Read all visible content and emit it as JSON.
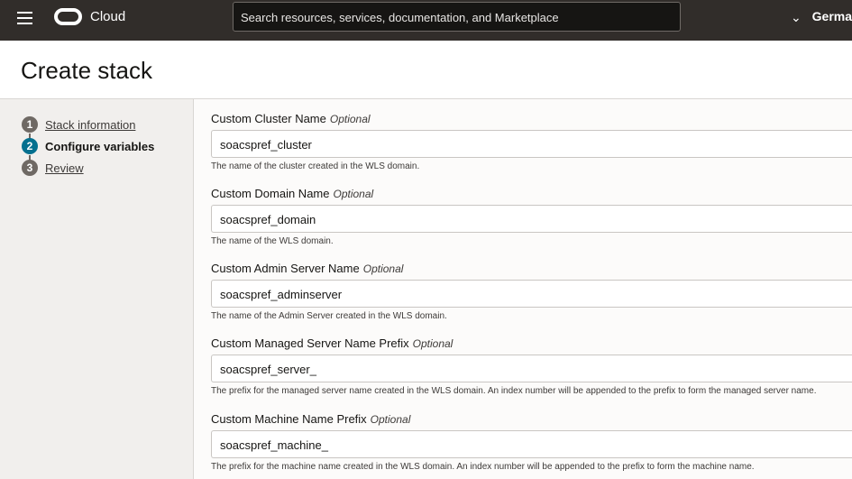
{
  "header": {
    "brand": "Cloud",
    "search_placeholder": "Search resources, services, documentation, and Marketplace",
    "region": "Germa"
  },
  "page_title": "Create stack",
  "steps": [
    {
      "num": "1",
      "label": "Stack information"
    },
    {
      "num": "2",
      "label": "Configure variables"
    },
    {
      "num": "3",
      "label": "Review"
    }
  ],
  "optional": "Optional",
  "fields": [
    {
      "label": "Custom Cluster Name",
      "value": "soacspref_cluster",
      "help": "The name of the cluster created in the WLS domain."
    },
    {
      "label": "Custom Domain Name",
      "value": "soacspref_domain",
      "help": "The name of the WLS domain."
    },
    {
      "label": "Custom Admin Server Name",
      "value": "soacspref_adminserver",
      "help": "The name of the Admin Server created in the WLS domain."
    },
    {
      "label": "Custom Managed Server Name Prefix",
      "value": "soacspref_server_",
      "help": "The prefix for the managed server name created in the WLS domain. An index number will be appended to the prefix to form the managed server name."
    },
    {
      "label": "Custom Machine Name Prefix",
      "value": "soacspref_machine_",
      "help": "The prefix for the machine name created in the WLS domain. An index number will be appended to the prefix to form the machine name."
    }
  ]
}
